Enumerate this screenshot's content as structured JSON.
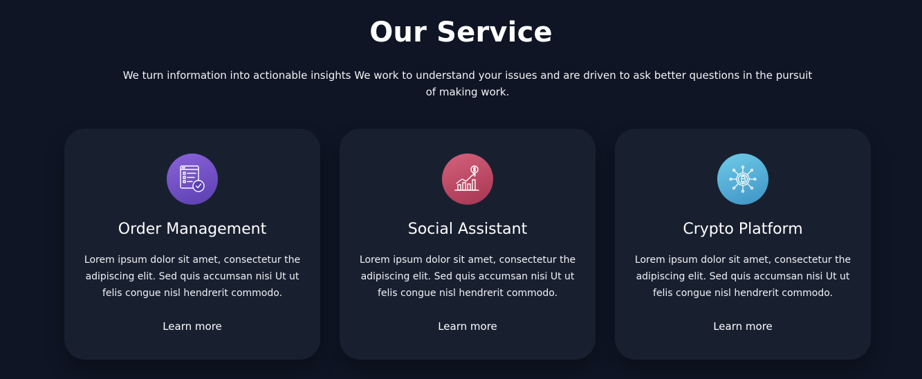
{
  "section": {
    "title": "Our Service",
    "subtitle": "We turn information into actionable insights We work to understand your issues and are driven to ask better questions in the pursuit of making work."
  },
  "cards": [
    {
      "title": "Order Management",
      "text": "Lorem ipsum dolor sit amet, consectetur the adipiscing elit. Sed quis accumsan nisi Ut ut felis congue nisl hendrerit commodo.",
      "link": "Learn more",
      "icon": "checklist-icon",
      "icon_color": "#6f4fc6"
    },
    {
      "title": "Social Assistant",
      "text": "Lorem ipsum dolor sit amet, consectetur the adipiscing elit. Sed quis accumsan nisi Ut ut felis congue nisl hendrerit commodo.",
      "link": "Learn more",
      "icon": "growth-chart-icon",
      "icon_color": "#bd4a67"
    },
    {
      "title": "Crypto Platform",
      "text": "Lorem ipsum dolor sit amet, consectetur the adipiscing elit. Sed quis accumsan nisi Ut ut felis congue nisl hendrerit commodo.",
      "link": "Learn more",
      "icon": "bitcoin-network-icon",
      "icon_color": "#55b2da"
    }
  ],
  "colors": {
    "background": "#0f1524",
    "card": "#182030",
    "text": "#ffffff"
  }
}
